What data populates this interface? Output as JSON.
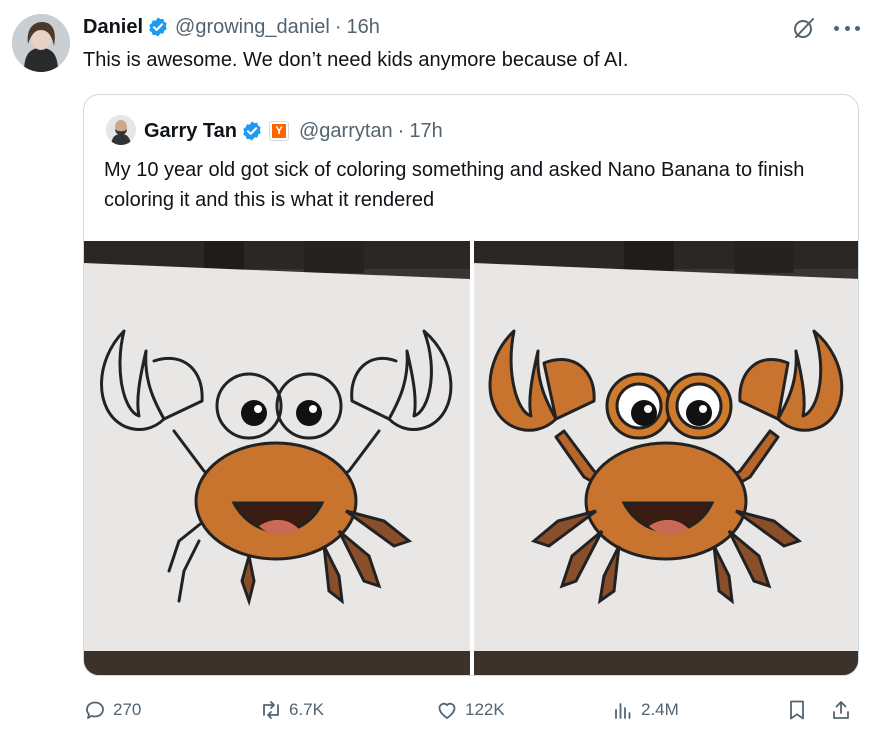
{
  "tweet": {
    "author_name": "Daniel",
    "handle": "@growing_daniel",
    "separator": "·",
    "time": "16h",
    "text": "This is awesome. We don’t need kids anymore because of AI."
  },
  "quoted_tweet": {
    "author_name": "Garry Tan",
    "badge_letter": "Y",
    "handle": "@garrytan",
    "separator": "·",
    "time": "17h",
    "text": "My 10 year old got sick of coloring something and asked Nano Banana to finish coloring it and this is what it rendered"
  },
  "actions": {
    "replies": "270",
    "reposts": "6.7K",
    "likes": "122K",
    "views": "2.4M"
  },
  "icons": [
    "verified-icon",
    "grok-icon",
    "more-icon",
    "yc-badge-icon",
    "reply-icon",
    "repost-icon",
    "like-icon",
    "views-icon",
    "bookmark-icon",
    "share-icon"
  ],
  "colors": {
    "text": "#0f1419",
    "secondary": "#536471",
    "verified": "#1d9bf0",
    "border": "#cfd9de",
    "yc_orange": "#ff6600",
    "crab_orange": "#d07a2c"
  }
}
